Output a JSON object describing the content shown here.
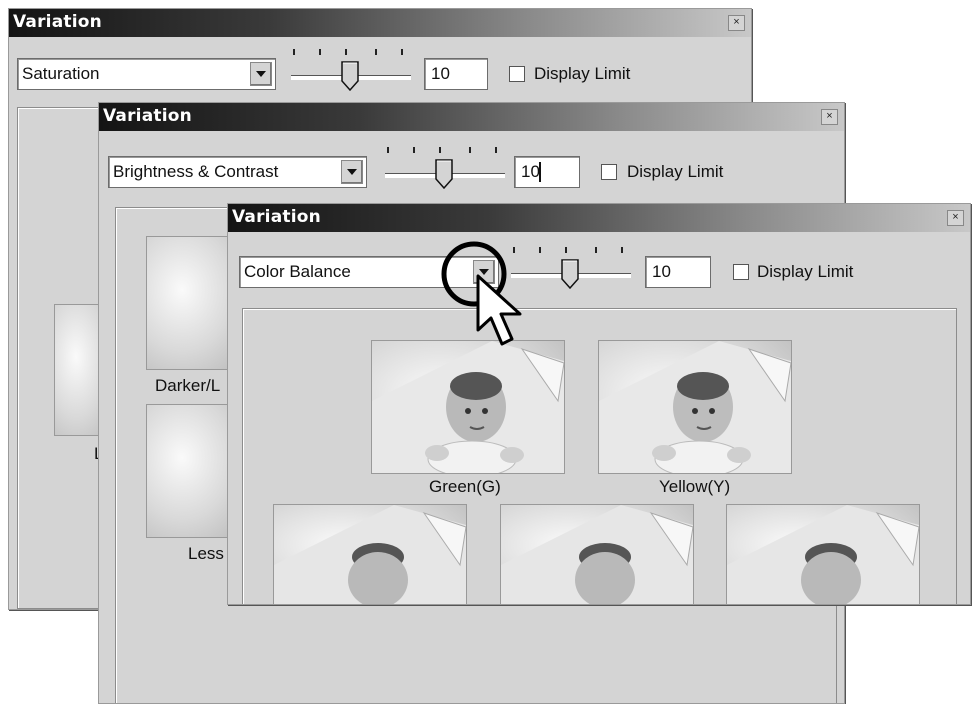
{
  "win1": {
    "title": "Variation",
    "close": "×",
    "mode": "Saturation",
    "value": "10",
    "display_limit": "Display Limit",
    "cap_left": "L"
  },
  "win2": {
    "title": "Variation",
    "close": "×",
    "mode": "Brightness & Contrast",
    "value": "10",
    "display_limit": "Display Limit",
    "cap_top": "Darker/L",
    "cap_bottom": "Less"
  },
  "win3": {
    "title": "Variation",
    "close": "×",
    "mode": "Color Balance",
    "value": "10",
    "display_limit": "Display Limit",
    "variations": [
      "Green(G)",
      "Yellow(Y)"
    ]
  },
  "colors": {
    "title_dark": "#141414",
    "window_bg": "#d4d4d4"
  },
  "icons": [
    "close-icon",
    "dropdown-arrow-icon",
    "slider-thumb-icon",
    "checkbox-icon",
    "mouse-cursor-icon",
    "highlight-circle"
  ]
}
